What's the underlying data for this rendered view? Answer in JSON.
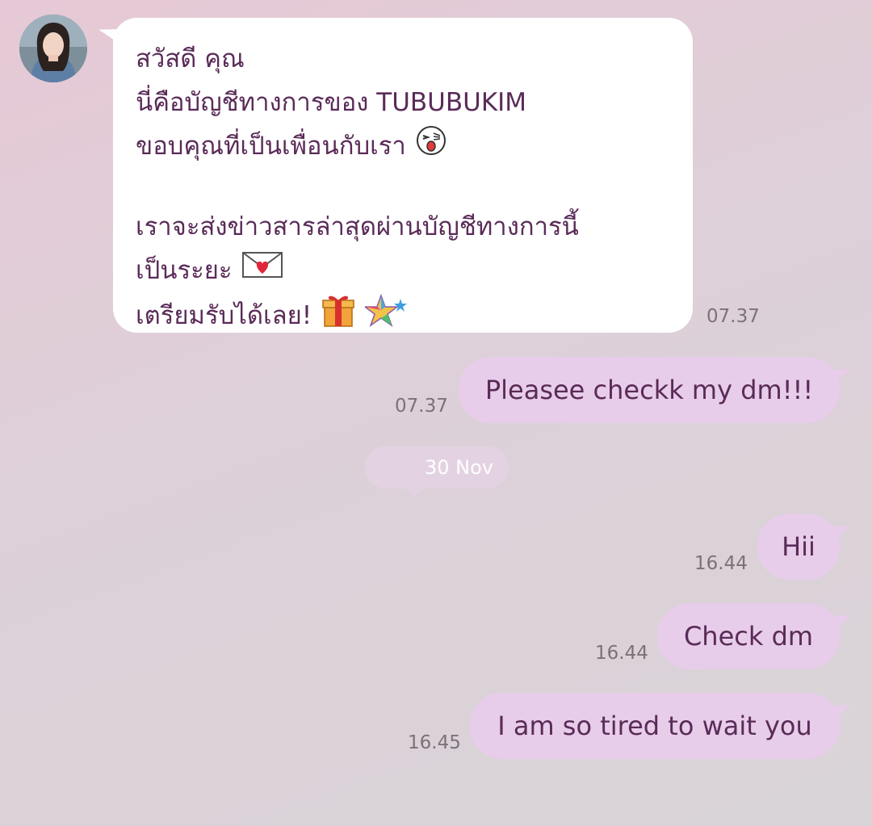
{
  "incoming": {
    "line1": "สวัสดี คุณ",
    "line2": "นี่คือบัญชีทางการของ TUBUBUKIM",
    "line3": "ขอบคุณที่เป็นเพื่อนกับเรา",
    "line4": "เราจะส่งข่าวสารล่าสุดผ่านบัญชีทางการนี้",
    "line5": "เป็นระยะ",
    "line6": "เตรียมรับได้เลย!",
    "time": "07.37",
    "emoji": [
      "wink-face-emoji",
      "love-letter-emoji",
      "gift-emoji",
      "stars-emoji"
    ]
  },
  "outgoing": [
    {
      "text": "Pleasee checkk my dm!!!",
      "time": "07.37"
    },
    {
      "text": "Hii",
      "time": "16.44"
    },
    {
      "text": "Check dm",
      "time": "16.44"
    },
    {
      "text": "I am so tired to wait you",
      "time": "16.45"
    }
  ],
  "date_separator": "30 Nov",
  "colors": {
    "incoming_bubble": "#ffffff",
    "outgoing_bubble": "#e7cdea",
    "text": "#5a2b58",
    "timestamp": "#7b7278"
  }
}
